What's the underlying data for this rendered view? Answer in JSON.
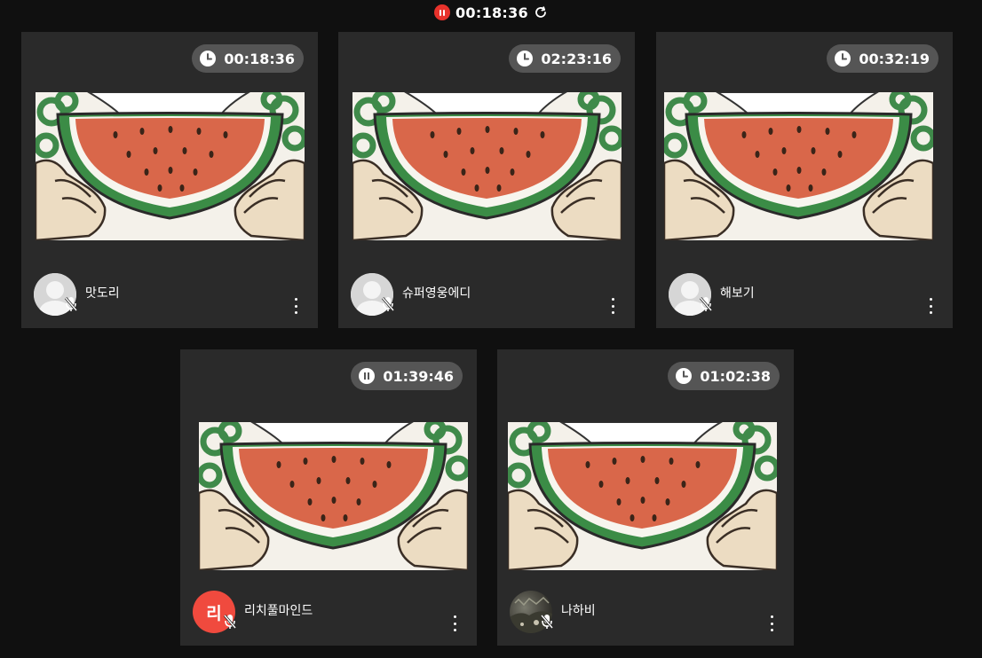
{
  "session": {
    "status": "recording-paused",
    "elapsed": "00:18:36"
  },
  "participants": [
    {
      "name": "맛도리",
      "timer": "00:18:36",
      "timer_icon": "clock-icon",
      "avatar": "default-user",
      "avatar_letter": "",
      "mic": "muted"
    },
    {
      "name": "슈퍼영웅에디",
      "timer": "02:23:16",
      "timer_icon": "clock-icon",
      "avatar": "default-user",
      "avatar_letter": "",
      "mic": "muted"
    },
    {
      "name": "해보기",
      "timer": "00:32:19",
      "timer_icon": "clock-icon",
      "avatar": "default-user",
      "avatar_letter": "",
      "mic": "muted"
    },
    {
      "name": "리치풀마인드",
      "timer": "01:39:46",
      "timer_icon": "pause-icon",
      "avatar": "letter",
      "avatar_letter": "리",
      "mic": "muted"
    },
    {
      "name": "나하비",
      "timer": "01:02:38",
      "timer_icon": "clock-icon",
      "avatar": "photo",
      "avatar_letter": "",
      "mic": "muted"
    }
  ],
  "colors": {
    "background": "#101010",
    "card": "#2a2a2a",
    "timer_pill": "#555555",
    "recording_red": "#e8322b",
    "letter_avatar": "#f04a3e"
  }
}
